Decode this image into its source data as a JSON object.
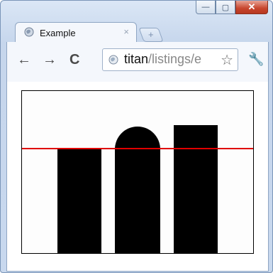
{
  "window": {
    "caption": {
      "minimize_glyph": "—",
      "maximize_glyph": "▢",
      "close_glyph": "✕"
    }
  },
  "tab": {
    "title": "Example",
    "close_glyph": "×",
    "icon": "globe-icon"
  },
  "new_tab": {
    "glyph": "+"
  },
  "toolbar": {
    "back_glyph": "←",
    "forward_glyph": "→",
    "reload_glyph": "C",
    "url_host": "titan",
    "url_path": "/listings/e",
    "star_glyph": "☆",
    "wrench_glyph": "🔧"
  },
  "colors": {
    "line": "#e00000",
    "shape": "#000000"
  }
}
